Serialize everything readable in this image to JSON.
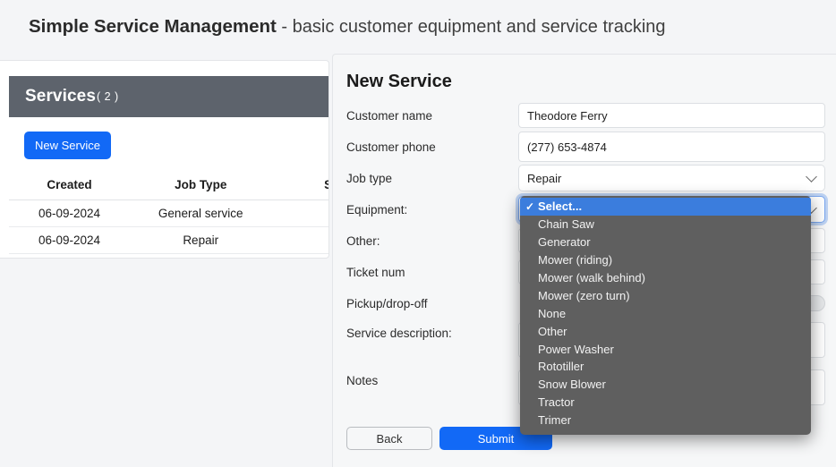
{
  "header": {
    "title_strong": "Simple Service Management",
    "title_sub": " - basic customer equipment and service tracking"
  },
  "services_panel": {
    "heading": "Services",
    "count_label": "( 2 )",
    "new_service_label": "New Service",
    "header_bg": "#5d636c",
    "accent": "#1269f6",
    "columns": [
      "Created",
      "Job Type",
      "S"
    ],
    "rows": [
      {
        "created": "06-09-2024",
        "job_type": "General service",
        "status": ""
      },
      {
        "created": "06-09-2024",
        "job_type": "Repair",
        "status": ""
      }
    ]
  },
  "form": {
    "heading": "New Service",
    "fields": {
      "customer_name": {
        "label": "Customer name",
        "value": "Theodore Ferry",
        "placeholder": ""
      },
      "customer_phone": {
        "label": "Customer phone",
        "value": "(277) 653-4874",
        "placeholder": ""
      },
      "job_type": {
        "label": "Job type",
        "value": "Repair"
      },
      "equipment": {
        "label": "Equipment:",
        "value": "Select..."
      },
      "other": {
        "label": "Other:",
        "value": "",
        "placeholder": ""
      },
      "ticket_num": {
        "label": "Ticket num",
        "value": "",
        "placeholder": ""
      },
      "pickup_dropoff": {
        "label": "Pickup/drop-off",
        "value": ""
      },
      "service_description": {
        "label": "Service description:",
        "value": "",
        "placeholder": ""
      },
      "notes": {
        "label": "Notes",
        "value": "",
        "placeholder": ""
      }
    },
    "buttons": {
      "back": "Back",
      "submit": "Submit"
    },
    "submit_color": "#1269f6"
  },
  "equipment_dropdown": {
    "open": true,
    "selected": "Select...",
    "check_glyph": "✓",
    "highlight_color": "#3b7ddd",
    "background": "#5f5f5f",
    "options": [
      "Select...",
      "Chain Saw",
      "Generator",
      "Mower (riding)",
      "Mower (walk behind)",
      "Mower (zero turn)",
      "None",
      "Other",
      "Power Washer",
      "Rototiller",
      "Snow Blower",
      "Tractor",
      "Trimer"
    ]
  }
}
